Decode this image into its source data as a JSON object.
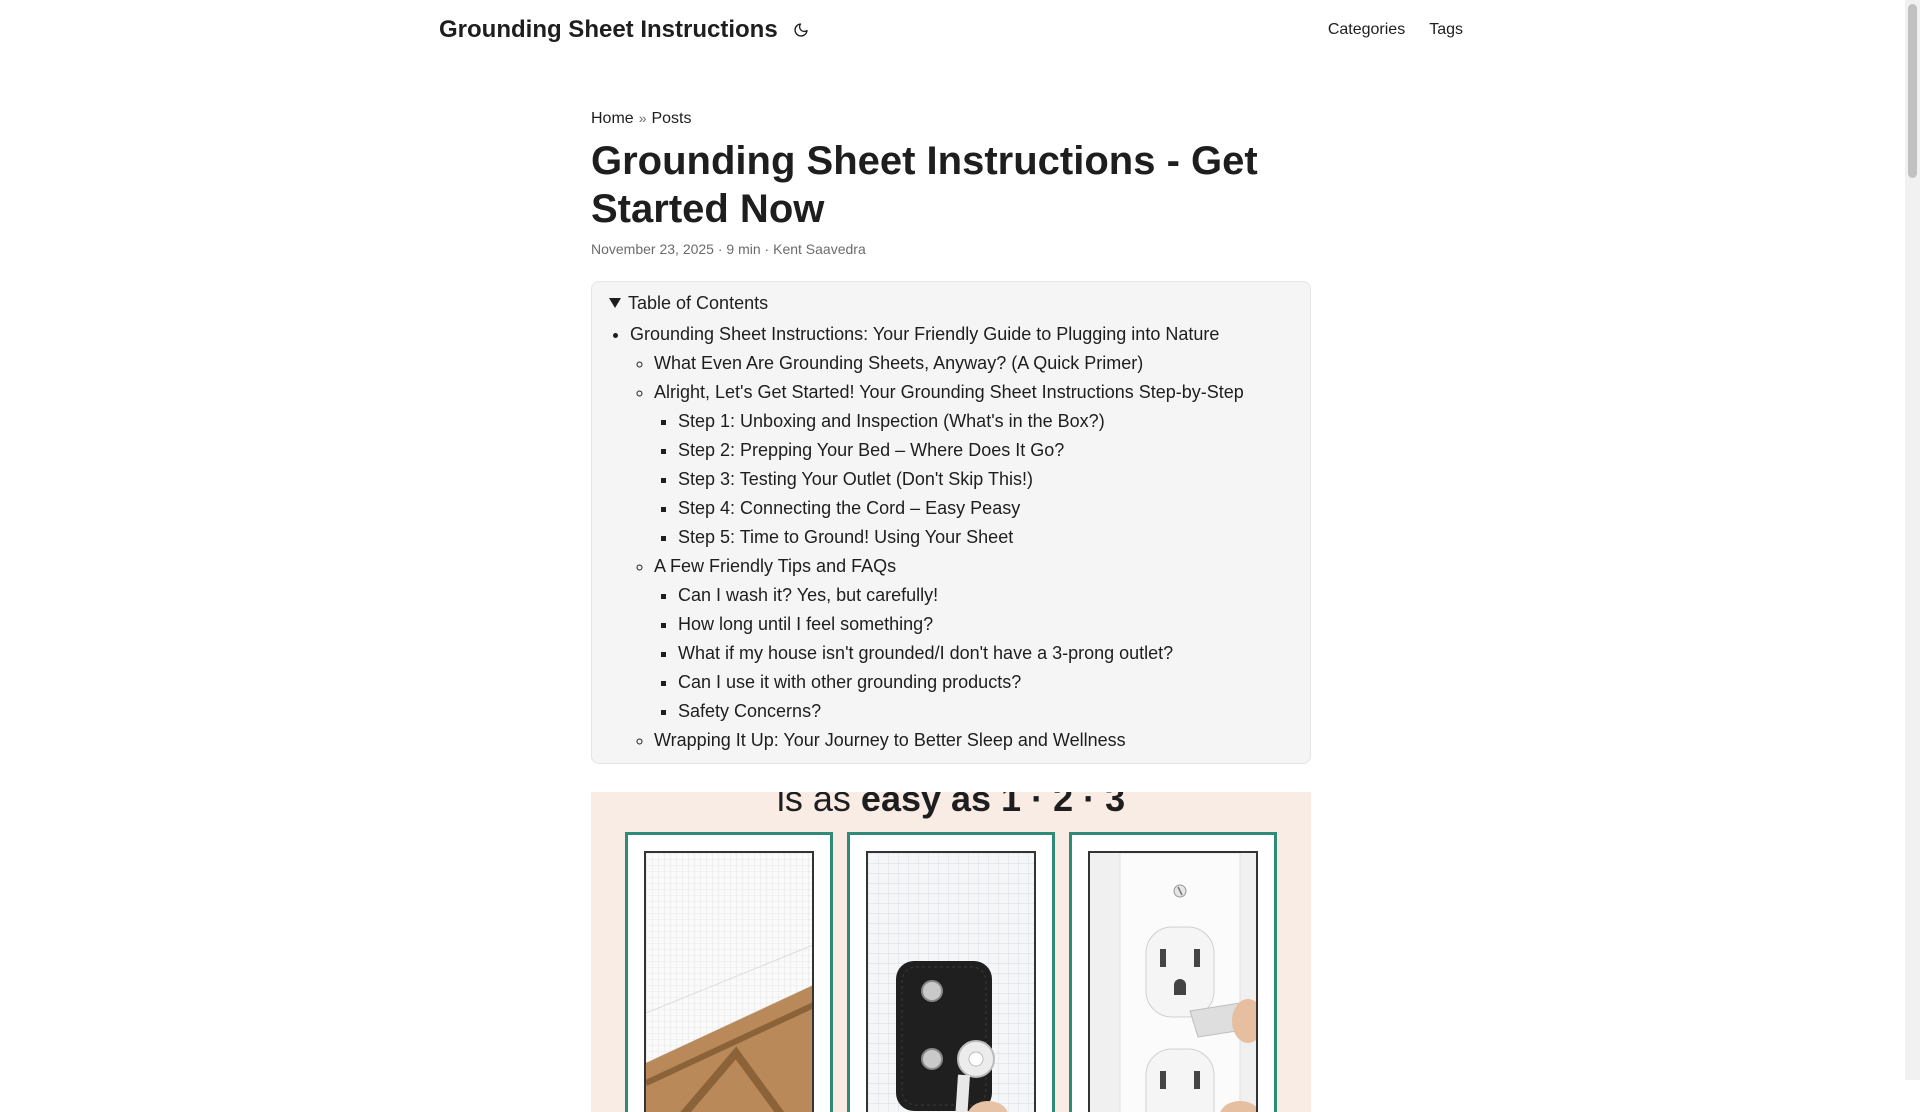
{
  "header": {
    "site_title": "Grounding Sheet Instructions",
    "menu": [
      {
        "label": "Categories"
      },
      {
        "label": "Tags"
      }
    ]
  },
  "breadcrumbs": {
    "home": "Home",
    "separator": "»",
    "posts": "Posts"
  },
  "post": {
    "title": "Grounding Sheet Instructions - Get Started Now",
    "meta": {
      "date": "November 23, 2025",
      "read_time": "9 min",
      "author": "Kent Saavedra",
      "separator": "·"
    }
  },
  "toc": {
    "summary": "Table of Contents",
    "h1": "Grounding Sheet Instructions: Your Friendly Guide to Plugging into Nature",
    "sections": [
      {
        "label": "What Even Are Grounding Sheets, Anyway? (A Quick Primer)",
        "items": []
      },
      {
        "label": "Alright, Let's Get Started! Your Grounding Sheet Instructions Step-by-Step",
        "items": [
          "Step 1: Unboxing and Inspection (What's in the Box?)",
          "Step 2: Prepping Your Bed – Where Does It Go?",
          "Step 3: Testing Your Outlet (Don't Skip This!)",
          "Step 4: Connecting the Cord – Easy Peasy",
          "Step 5: Time to Ground! Using Your Sheet"
        ]
      },
      {
        "label": "A Few Friendly Tips and FAQs",
        "items": [
          "Can I wash it? Yes, but carefully!",
          "How long until I feel something?",
          "What if my house isn't grounded/I don't have a 3-prong outlet?",
          "Can I use it with other grounding products?",
          "Safety Concerns?"
        ]
      },
      {
        "label": "Wrapping It Up: Your Journey to Better Sleep and Wellness",
        "items": []
      }
    ]
  },
  "hero": {
    "caption_light": "is as",
    "caption_bold": "easy as 1 · 2 · 3",
    "panels": [
      "fitted-sheet-on-bed",
      "grounding-cord-snap",
      "wall-outlet-plug"
    ],
    "colors": {
      "background": "#f8ece4",
      "frame": "#2f8a78"
    }
  },
  "icons": {
    "theme_toggle": "moon-icon"
  }
}
